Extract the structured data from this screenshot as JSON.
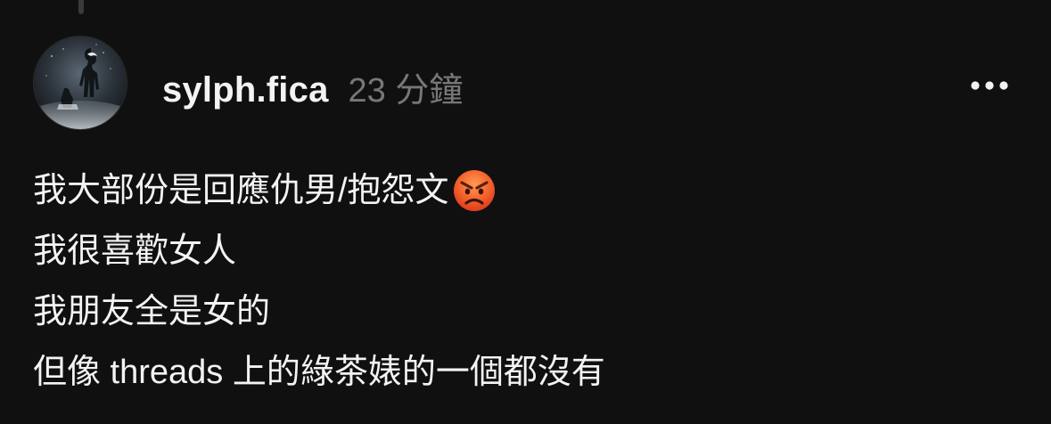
{
  "post": {
    "username": "sylph.fica",
    "timestamp": "23 分鐘",
    "more_icon": "more-horizontal-icon",
    "lines": [
      "我大部份是回應仇男/抱怨文",
      "我很喜歡女人",
      "我朋友全是女的",
      "但像 threads 上的綠茶婊的一個都沒有"
    ],
    "line_1_emoji": "angry-face-emoji"
  },
  "colors": {
    "background": "#101010",
    "text_primary": "#f3f3f3",
    "text_secondary": "#777777",
    "thread_line": "#3a3a3a"
  }
}
